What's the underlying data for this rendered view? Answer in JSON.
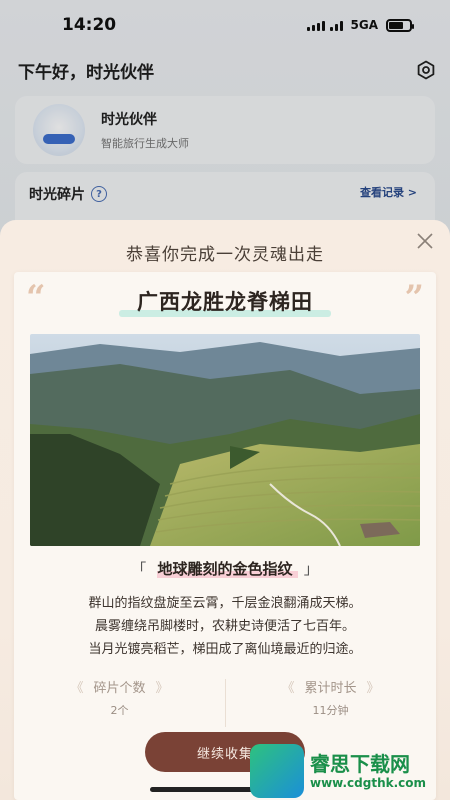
{
  "status_bar": {
    "time": "14:20",
    "network": "5GA"
  },
  "header": {
    "greeting": "下午好，时光伙伴"
  },
  "partner_card": {
    "name": "时光伙伴",
    "subtitle": "智能旅行生成大师"
  },
  "fragments": {
    "title": "时光碎片",
    "help_symbol": "?",
    "view_record": "查看记录 >"
  },
  "modal": {
    "title": "恭喜你完成一次灵魂出走",
    "place": "广西龙胜龙脊梯田",
    "tagline_open": "「",
    "tagline": "地球雕刻的金色指纹",
    "tagline_close": "」",
    "poem": [
      "群山的指纹盘旋至云霄，千层金浪翻涌成天梯。",
      "晨雾缠绕吊脚楼时，农耕史诗便活了七百年。",
      "当月光镀亮稻芒，梯田成了离仙境最近的归途。"
    ],
    "stats": [
      {
        "label": "碎片个数",
        "value": "2个"
      },
      {
        "label": "累计时长",
        "value": "11分钟"
      }
    ],
    "continue_button": "继续收集"
  },
  "watermark": {
    "line1": "睿思下载网",
    "line2": "www.cdgthk.com"
  },
  "colors": {
    "button": "#7a4236",
    "modal_bg": "#f7ece2",
    "accent_blue": "#2c4d8f"
  }
}
